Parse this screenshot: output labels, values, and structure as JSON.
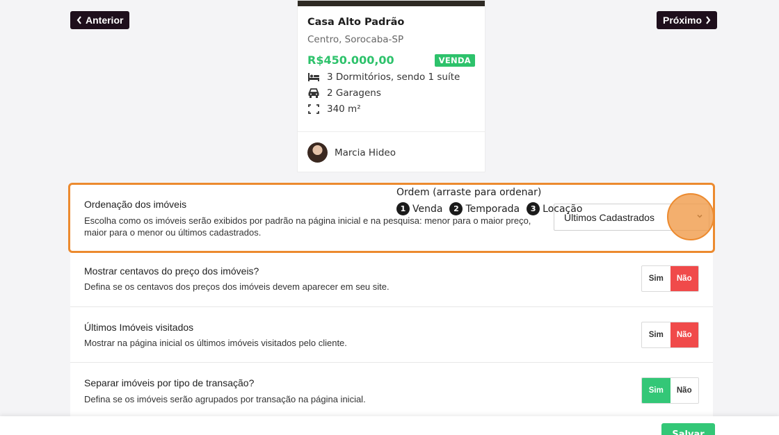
{
  "nav": {
    "prev_label": "Anterior",
    "next_label": "Próximo"
  },
  "property_card": {
    "title": "Casa Alto Padrão",
    "location": "Centro, Sorocaba-SP",
    "price": "R$450.000,00",
    "badge": "VENDA",
    "features": [
      {
        "icon": "bed-icon",
        "text": "3 Dormitórios, sendo 1 suíte"
      },
      {
        "icon": "car-icon",
        "text": "2 Garagens"
      },
      {
        "icon": "area-icon",
        "text": "340 m²"
      }
    ],
    "agent_name": "Marcia Hideo"
  },
  "settings": {
    "ordering": {
      "title": "Ordenação dos imóveis",
      "description": "Escolha como os imóveis serão exibidos por padrão na página inicial e na pesquisa: menor para o maior preço, maior para o menor ou últimos cadastrados.",
      "selected": "Últimos Cadastrados"
    },
    "cents": {
      "title": "Mostrar centavos do preço dos imóveis?",
      "description": "Defina se os centavos dos preços dos imóveis devem aparecer em seu site.",
      "yes": "Sim",
      "no": "Não",
      "value": "Não"
    },
    "recent": {
      "title": "Últimos Imóveis visitados",
      "description": "Mostrar na página inicial os últimos imóveis visitados pelo cliente.",
      "yes": "Sim",
      "no": "Não",
      "value": "Não"
    },
    "separate": {
      "title": "Separar imóveis por tipo de transação?",
      "description": "Defina se os imóveis serão agrupados por transação na página inicial.",
      "order_title": "Ordem (arraste para ordenar)",
      "order": [
        {
          "n": "1",
          "label": "Venda"
        },
        {
          "n": "2",
          "label": "Temporada"
        },
        {
          "n": "3",
          "label": "Locação"
        }
      ],
      "yes": "Sim",
      "no": "Não",
      "value": "Sim"
    }
  },
  "footer": {
    "save_label": "Salvar"
  },
  "colors": {
    "accent_green": "#33c777",
    "danger_red": "#f04a4a",
    "highlight_orange": "#ec8a2f",
    "dark": "#1e0f1c"
  }
}
